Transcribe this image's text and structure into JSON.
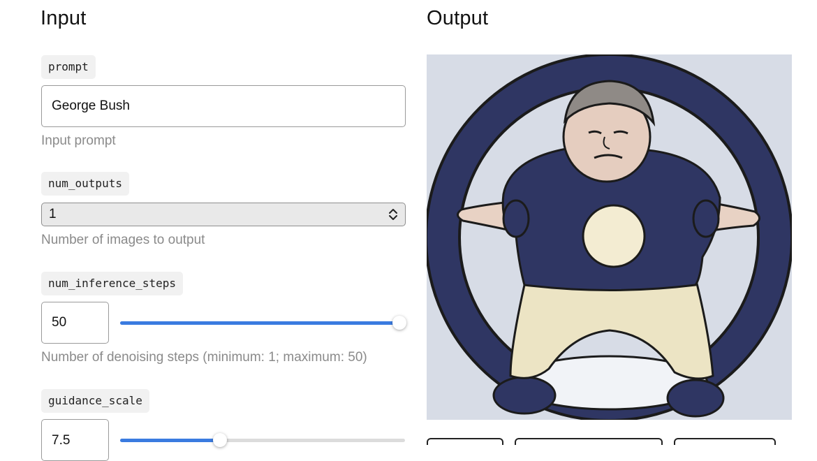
{
  "input": {
    "heading": "Input",
    "prompt": {
      "tag": "prompt",
      "value": "George Bush",
      "hint": "Input prompt"
    },
    "num_outputs": {
      "tag": "num_outputs",
      "value": "1",
      "hint": "Number of images to output"
    },
    "num_inference_steps": {
      "tag": "num_inference_steps",
      "value": "50",
      "hint": "Number of denoising steps (minimum: 1; maximum: 50)",
      "slider_fraction": 1.0
    },
    "guidance_scale": {
      "tag": "guidance_scale",
      "value": "7.5",
      "slider_fraction": 0.35
    }
  },
  "output": {
    "heading": "Output",
    "image_icon": "cartoon-character-image"
  },
  "colors": {
    "accent": "#3a7be0",
    "tag_bg": "#f1f1f1",
    "hint": "#8a8a8a"
  }
}
